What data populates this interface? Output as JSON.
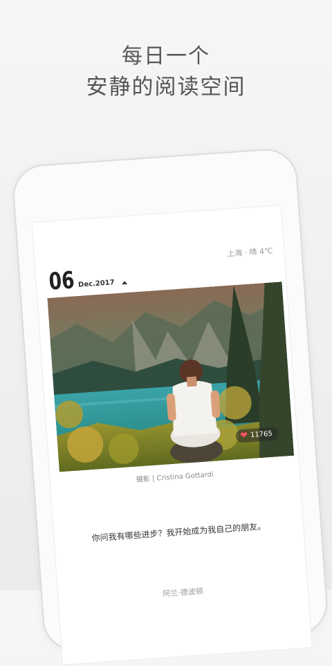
{
  "headline": {
    "line1": "每日一个",
    "line2": "安静的阅读空间"
  },
  "card": {
    "day": "06",
    "month": "Dec.2017",
    "weather": "上海 · 晴 4℃",
    "likes": "11765",
    "photo_credit": "摄影 | Cristina Gottardi",
    "quote": "你问我有哪些进步？我开始成为我自己的朋友。",
    "author": "阿兰·德波顿"
  },
  "icons": {
    "like": "heart-icon",
    "date_toggle": "triangle-up-icon"
  },
  "colors": {
    "heart": "#ff4f6a",
    "headline": "#555555"
  }
}
